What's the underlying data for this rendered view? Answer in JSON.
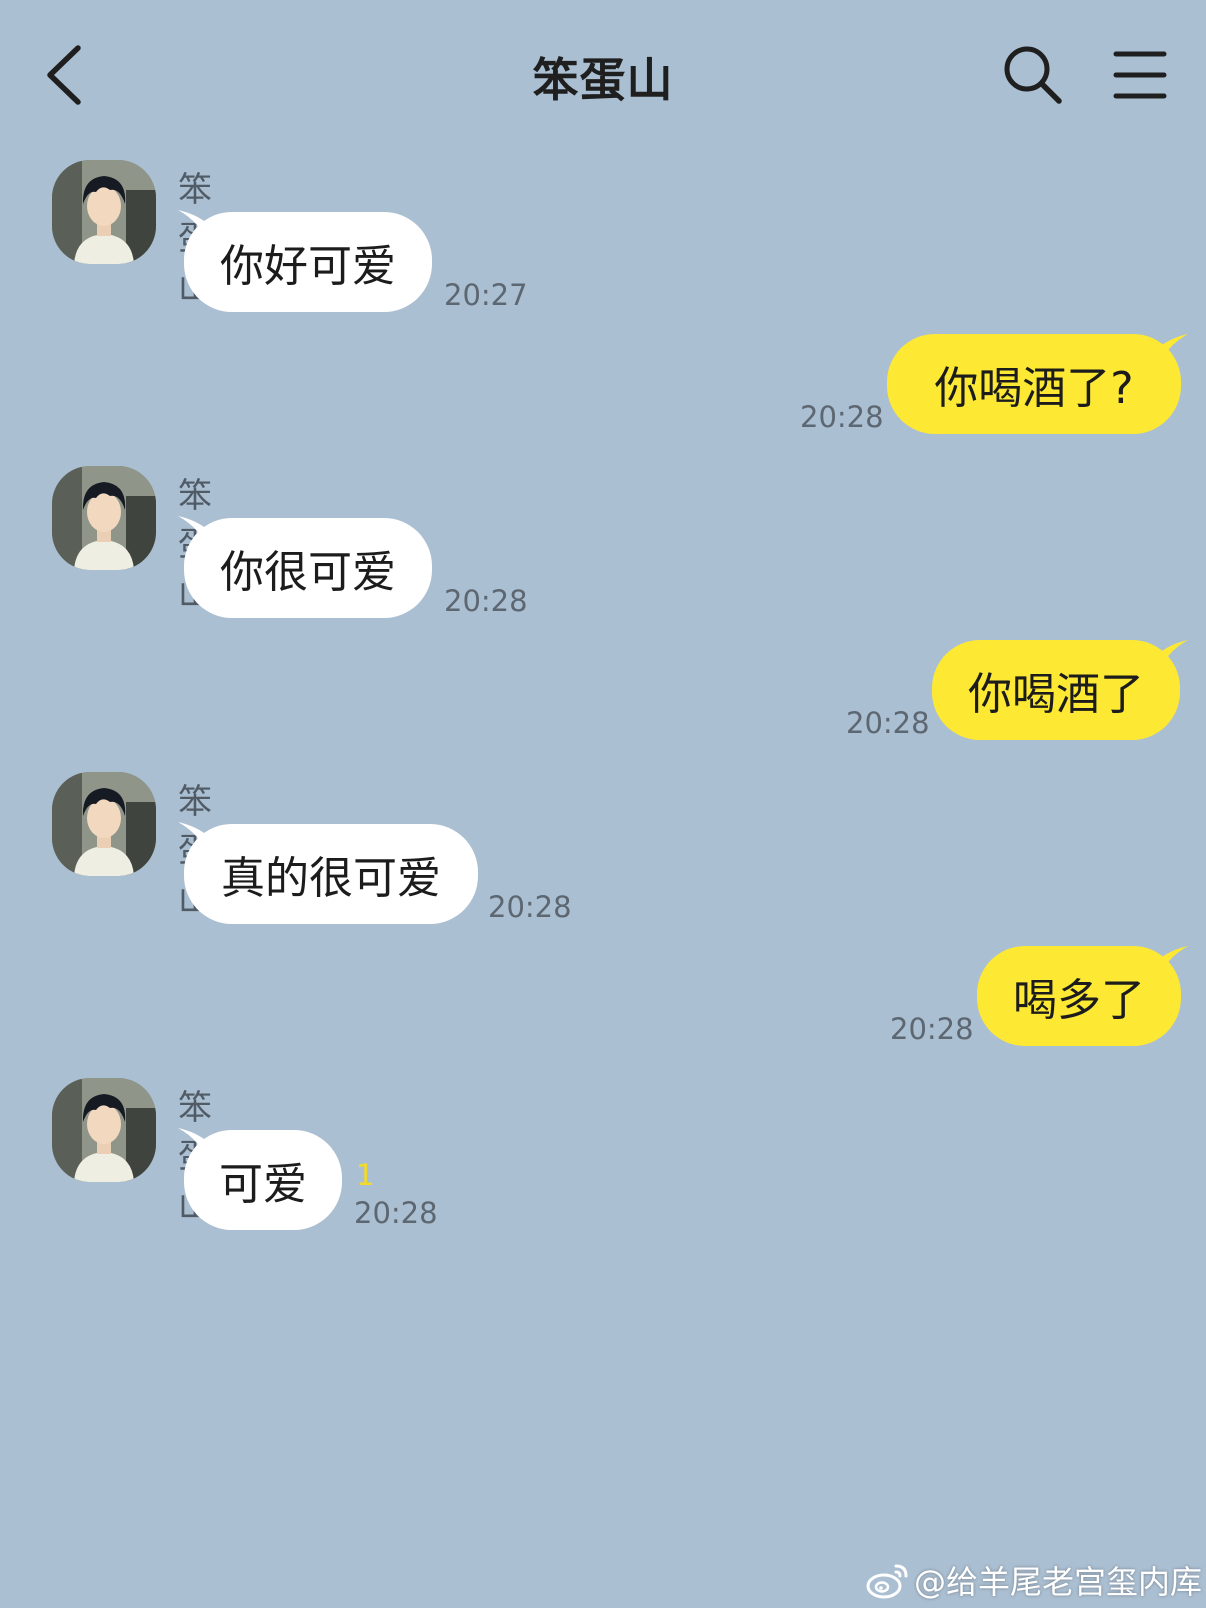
{
  "header": {
    "title": "笨蛋山",
    "back_icon": "chevron-left-icon",
    "search_icon": "search-icon",
    "menu_icon": "hamburger-menu-icon"
  },
  "colors": {
    "background": "#abbfd2",
    "incoming_bubble": "#ffffff",
    "outgoing_bubble": "#fde933",
    "unread_count": "#f2d92a"
  },
  "messages": [
    {
      "direction": "incoming",
      "sender": "笨蛋山",
      "text": "你好可爱",
      "time": "20:27"
    },
    {
      "direction": "outgoing",
      "text": "你喝酒了?",
      "time": "20:28"
    },
    {
      "direction": "incoming",
      "sender": "笨蛋山",
      "text": "你很可爱",
      "time": "20:28"
    },
    {
      "direction": "outgoing",
      "text": "你喝酒了",
      "time": "20:28"
    },
    {
      "direction": "incoming",
      "sender": "笨蛋山",
      "text": "真的很可爱",
      "time": "20:28"
    },
    {
      "direction": "outgoing",
      "text": "喝多了",
      "time": "20:28"
    },
    {
      "direction": "incoming",
      "sender": "笨蛋山",
      "text": "可爱",
      "time": "20:28",
      "unread": "1"
    }
  ],
  "watermark": {
    "icon": "weibo-logo-icon",
    "text": "@给羊尾老宫玺内库"
  }
}
